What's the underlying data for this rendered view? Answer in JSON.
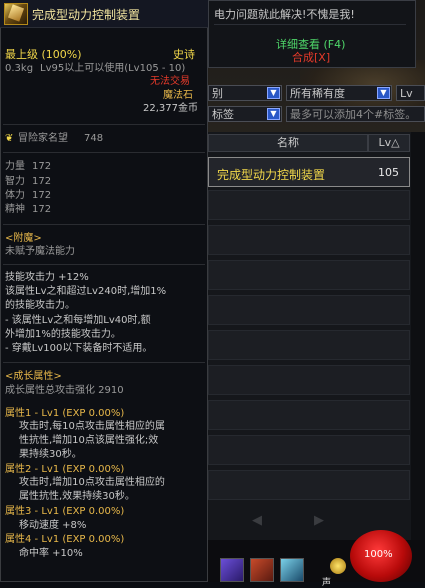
{
  "notice": {
    "message": "电力问题就此解决!不愧是我!",
    "detail_link": "详细查看 (F4)",
    "synth_link": "合成[X]"
  },
  "filters": {
    "category": "别",
    "rarity": "所有稀有度",
    "level": "Lv",
    "tag": "标签",
    "tag_search_placeholder": "最多可以添加4个#标签。"
  },
  "list": {
    "col_name": "名称",
    "col_lv": "Lv△",
    "rows": [
      {
        "name": "完成型动力控制装置",
        "lv": "105"
      }
    ],
    "prev": "◀",
    "next": "▶"
  },
  "hud": {
    "orb_text": "100%",
    "coin_text": "声"
  },
  "tooltip": {
    "title": "完成型动力控制装置",
    "grade": "最上级 (100%)",
    "rarity": "史诗",
    "weight": "0.3kg",
    "req": "Lv95以上可以使用(Lv105 - 10)",
    "trade": "无法交易",
    "type": "魔法石",
    "price": "22,377金币",
    "fame_label": "冒险家名望",
    "fame_value": "748",
    "stats": [
      {
        "label": "力量",
        "value": "172"
      },
      {
        "label": "智力",
        "value": "172"
      },
      {
        "label": "体力",
        "value": "172"
      },
      {
        "label": "精神",
        "value": "172"
      }
    ],
    "enchant_header": "<附魔>",
    "enchant_text": "未赋予魔法能力",
    "skill_lines": [
      "技能攻击力 +12%",
      "该属性Lv之和超过Lv240时,增加1%",
      "的技能攻击力。",
      "- 该属性Lv之和每增加Lv40时,额",
      "外增加1%的技能攻击力。",
      "- 穿戴Lv100以下装备时不适用。"
    ],
    "growth_header": "<成长属性>",
    "growth_total": "成长属性总攻击强化 2910",
    "growth": [
      {
        "head": "属性1 - Lv1 (EXP 0.00%)",
        "lines": [
          "攻击时,每10点攻击属性相应的属",
          "性抗性,增加10点该属性强化;效",
          "果持续30秒。"
        ]
      },
      {
        "head": "属性2 - Lv1 (EXP 0.00%)",
        "lines": [
          "攻击时,增加10点攻击属性相应的",
          "属性抗性,效果持续30秒。"
        ]
      },
      {
        "head": "属性3 - Lv1 (EXP 0.00%)",
        "lines": [
          "移动速度 +8%"
        ]
      },
      {
        "head": "属性4 - Lv1 (EXP 0.00%)",
        "lines": [
          "命中率 +10%"
        ]
      }
    ]
  }
}
